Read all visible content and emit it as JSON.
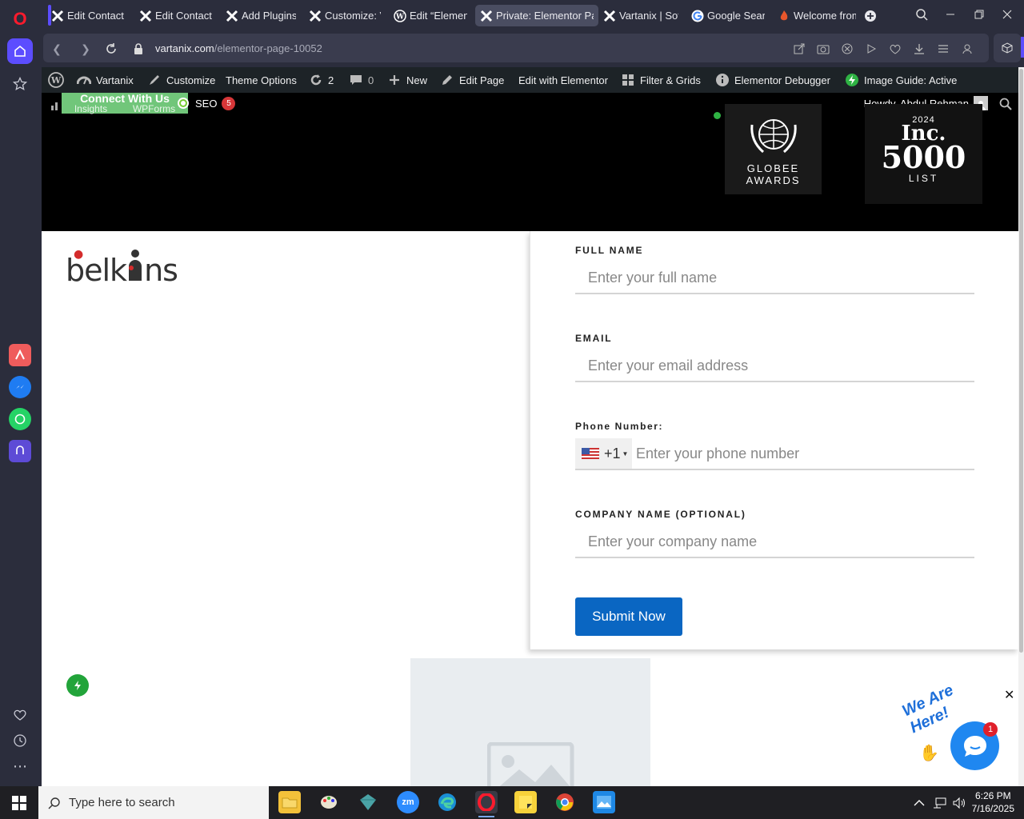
{
  "browser": {
    "tabs": [
      {
        "label": "Edit Contact F",
        "icon": "elementor-x-icon"
      },
      {
        "label": "Edit Contact F",
        "icon": "elementor-x-icon"
      },
      {
        "label": "Add Plugins ‹",
        "icon": "elementor-x-icon"
      },
      {
        "label": "Customize: Va",
        "icon": "elementor-x-icon"
      },
      {
        "label": "Edit “Elemento",
        "icon": "wordpress-icon"
      },
      {
        "label": "Private: Elementor Page",
        "icon": "elementor-x-icon",
        "active": true
      },
      {
        "label": "Vartanix | Softw",
        "icon": "elementor-x-icon"
      },
      {
        "label": "Google Search",
        "icon": "google-icon"
      },
      {
        "label": "Welcome from",
        "icon": "fire-icon"
      }
    ],
    "url_host": "vartanix.com",
    "url_path": "/elementor-page-10052"
  },
  "wp_admin_bar": {
    "site_name": "Vartanix",
    "customize": "Customize",
    "theme_options": "Theme Options",
    "updates_count": "2",
    "comments_count": "0",
    "new": "New",
    "edit_page": "Edit Page",
    "edit_with_elementor": "Edit with Elementor",
    "filter_grids": "Filter & Grids",
    "elementor_debugger": "Elementor Debugger",
    "image_guide": "Image Guide: Active",
    "insights": "Insights",
    "wpforms": "WPForms",
    "seo": "SEO",
    "seo_badge": "5",
    "howdy": "Howdy, Abdul Rehman"
  },
  "hero": {
    "connect_with_us": "Connect With Us",
    "award1_line1": "GLOBEE",
    "award1_line2": "AWARDS",
    "award2_year": "2024",
    "award2_brand": "Inc.",
    "award2_number": "5000",
    "award2_list": "LIST"
  },
  "logo": {
    "text_pre": "belk",
    "text_post": "ns"
  },
  "form": {
    "full_name_label": "FULL NAME",
    "full_name_placeholder": "Enter your full name",
    "email_label": "EMAIL",
    "email_placeholder": "Enter your email address",
    "phone_label": "Phone Number:",
    "phone_country_code": "+1",
    "phone_placeholder": "Enter your phone number",
    "company_label": "COMPANY NAME (OPTIONAL)",
    "company_placeholder": "Enter your company name",
    "submit_label": "Submit Now"
  },
  "chat": {
    "tagline": "We Are Here!",
    "unread": "1"
  },
  "taskbar": {
    "search_placeholder": "Type here to search",
    "time": "6:26 PM",
    "date": "7/16/2025"
  },
  "colors": {
    "accent_blue": "#0a66c2",
    "wp_bar": "#1d2327",
    "opera_red": "#ff1b2d",
    "opera_purple": "#5c4dff"
  }
}
